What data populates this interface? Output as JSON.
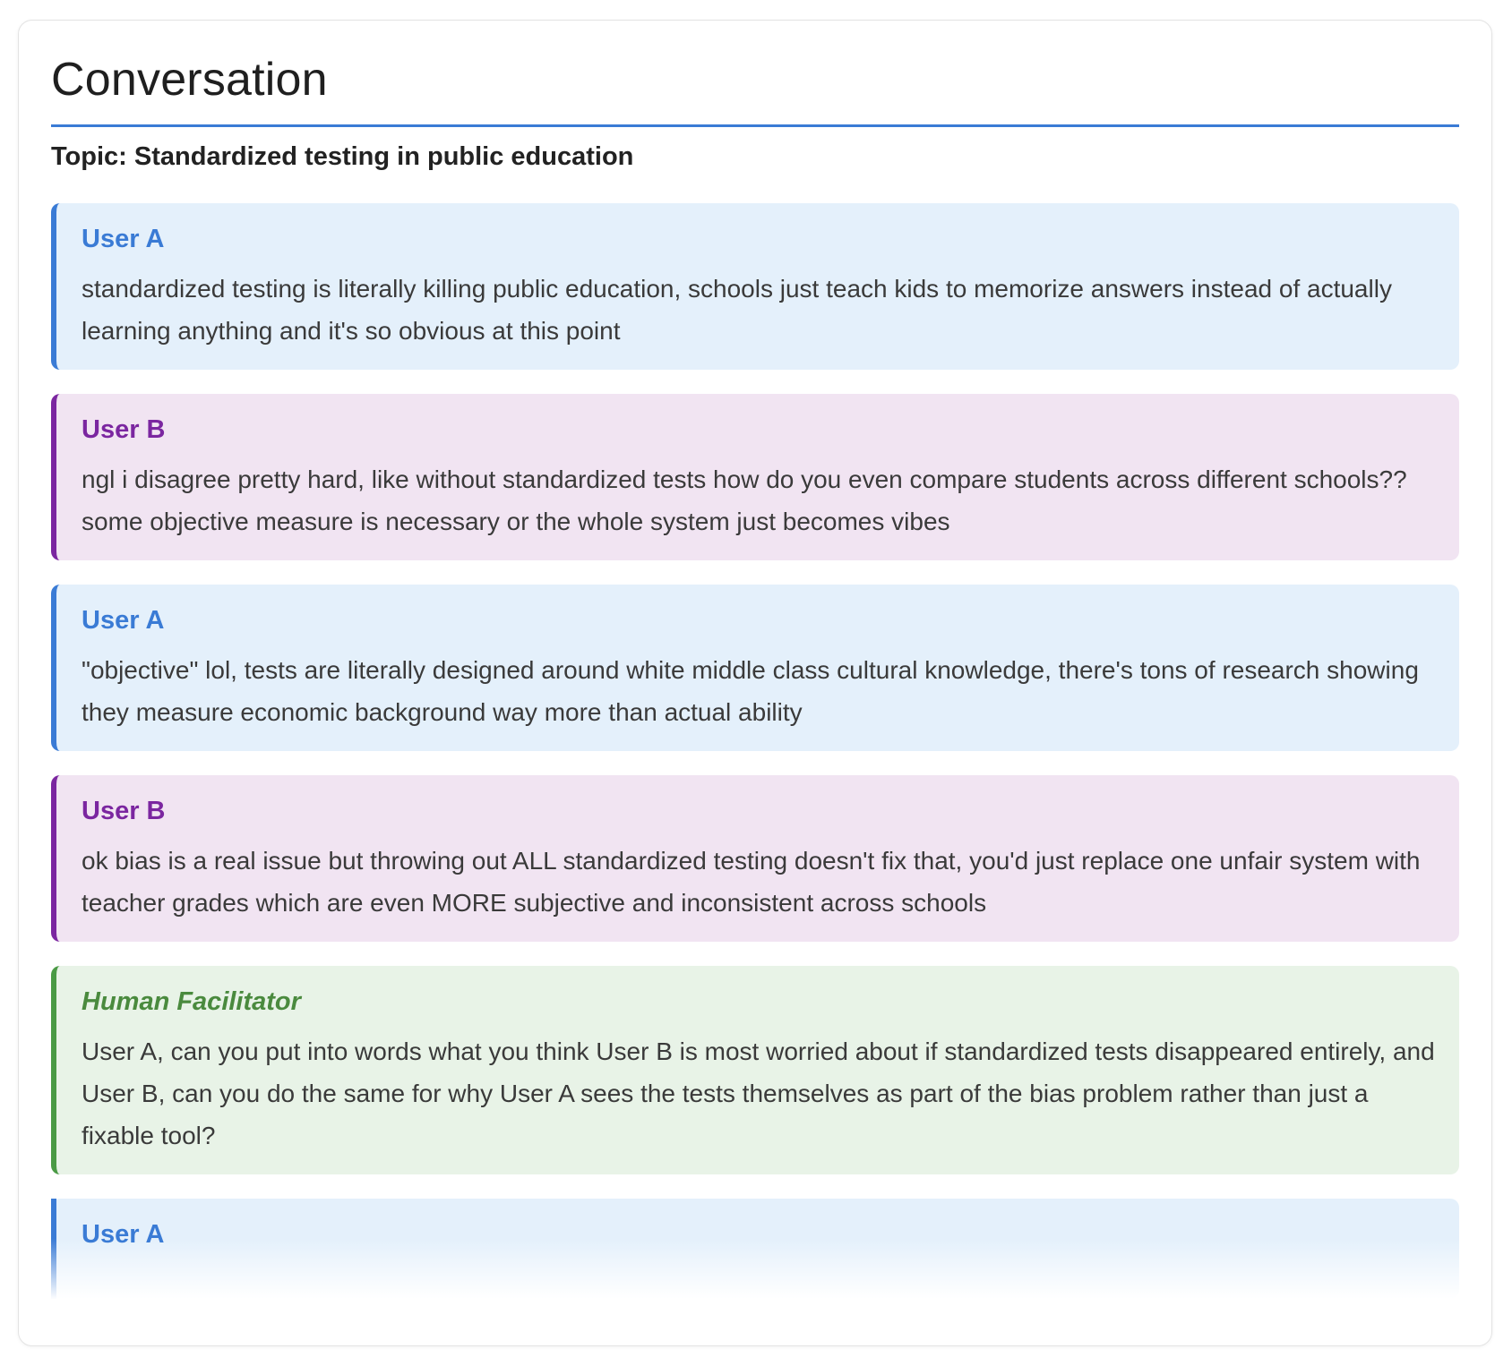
{
  "header": {
    "title": "Conversation",
    "topic": "Topic: Standardized testing in public education"
  },
  "colors": {
    "accent": "#3a7bd5",
    "user_a": "#3a7bd5",
    "user_b": "#7b26a0",
    "facilitator": "#4a8a3e"
  },
  "messages": [
    {
      "speaker": "User A",
      "text": "standardized testing is literally killing public education, schools just teach kids to memorize answers instead of actually learning anything and it's so obvious at this point"
    },
    {
      "speaker": "User B",
      "text": "ngl i disagree pretty hard, like without standardized tests how do you even compare students across different schools?? some objective measure is necessary or the whole system just becomes vibes"
    },
    {
      "speaker": "User A",
      "text": "\"objective\" lol, tests are literally designed around white middle class cultural knowledge, there's tons of research showing they measure economic background way more than actual ability"
    },
    {
      "speaker": "User B",
      "text": "ok bias is a real issue but throwing out ALL standardized testing doesn't fix that, you'd just replace one unfair system with teacher grades which are even MORE subjective and inconsistent across schools"
    },
    {
      "speaker": "Human Facilitator",
      "text": "User A, can you put into words what you think User B is most worried about if standardized tests disappeared entirely, and User B, can you do the same for why User A sees the tests themselves as part of the bias problem rather than just a fixable tool?"
    },
    {
      "speaker": "User A"
    }
  ]
}
